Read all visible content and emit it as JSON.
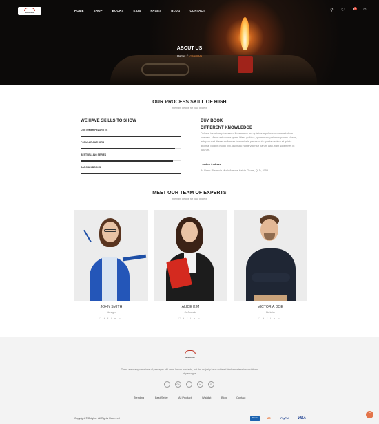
{
  "header": {
    "logo_text": "BOIGHOR",
    "nav": [
      "HOME",
      "SHOP",
      "BOOKS",
      "KIDS",
      "PAGES",
      "BLOG",
      "CONTACT"
    ],
    "icons": [
      "search-icon",
      "heart-icon",
      "cart-icon",
      "user-icon"
    ],
    "cart_count": "0"
  },
  "hero": {
    "title": "ABOUT US",
    "breadcrumb_home": "Home",
    "breadcrumb_sep": "/",
    "breadcrumb_current": "About Us"
  },
  "process": {
    "title": "OUR PROCESS SKILL OF HIGH",
    "subtitle": "the right people for your project",
    "skills_heading": "WE HAVE SKILLS TO SHOW",
    "skills": [
      {
        "label": "CUSTOMER FAVORITES",
        "percent": 100
      },
      {
        "label": "POPULAR AUTHORS",
        "percent": 94
      },
      {
        "label": "BESTSELLING SERIES",
        "percent": 92
      },
      {
        "label": "BARGAIN BOOKS",
        "percent": 100
      }
    ],
    "buy_heading_1": "BUY BOOK",
    "buy_heading_2": "DIFFERENT KNOWLEDGE",
    "buy_text": "Dolorss ius ariam ph assecul Nonummus mo quiehas mpolosean consuetudium lorehum. Mirum est notare quam littera gothica, quam nunc putamus parum claram, anteposuerit litterarum formas humanitatis per seacula quarta decima et quinta decima. Eodem modo typi, qui nunc nobis videntur parum clari, fiant sollemnes in futurum.",
    "address_heading": "London Address",
    "address": "34 Parer Place via Musk Avenue Kelvin Grove, QLD, 4059"
  },
  "team": {
    "title": "MEET OUR TEAM OF EXPERTS",
    "subtitle": "the right people for your project",
    "members": [
      {
        "name": "JOHN SMITH",
        "role": "Manager"
      },
      {
        "name": "ALICE KIM",
        "role": "Co-Founder"
      },
      {
        "name": "VICTORIA DOE",
        "role": "Marketer"
      }
    ],
    "social_icons": [
      "twitter-icon",
      "tumblr-icon",
      "facebook-icon",
      "linkedin-icon",
      "pinterest-icon"
    ]
  },
  "footer": {
    "logo_text": "BOIGHOR",
    "text": "There are many variations of passages of Lorem Ipsum available, but the majority have suffered duskam alteration variations of passages",
    "social": [
      "f",
      "G+",
      "t",
      "in",
      "P"
    ],
    "links": [
      "Trending",
      "Best Seller",
      "All Product",
      "Wishlist",
      "Blog",
      "Contact"
    ],
    "copyright": "Copyright © Boighor. All Rights Reserved",
    "payments": [
      "Maestro",
      "MC",
      "PayPal",
      "VISA"
    ]
  }
}
